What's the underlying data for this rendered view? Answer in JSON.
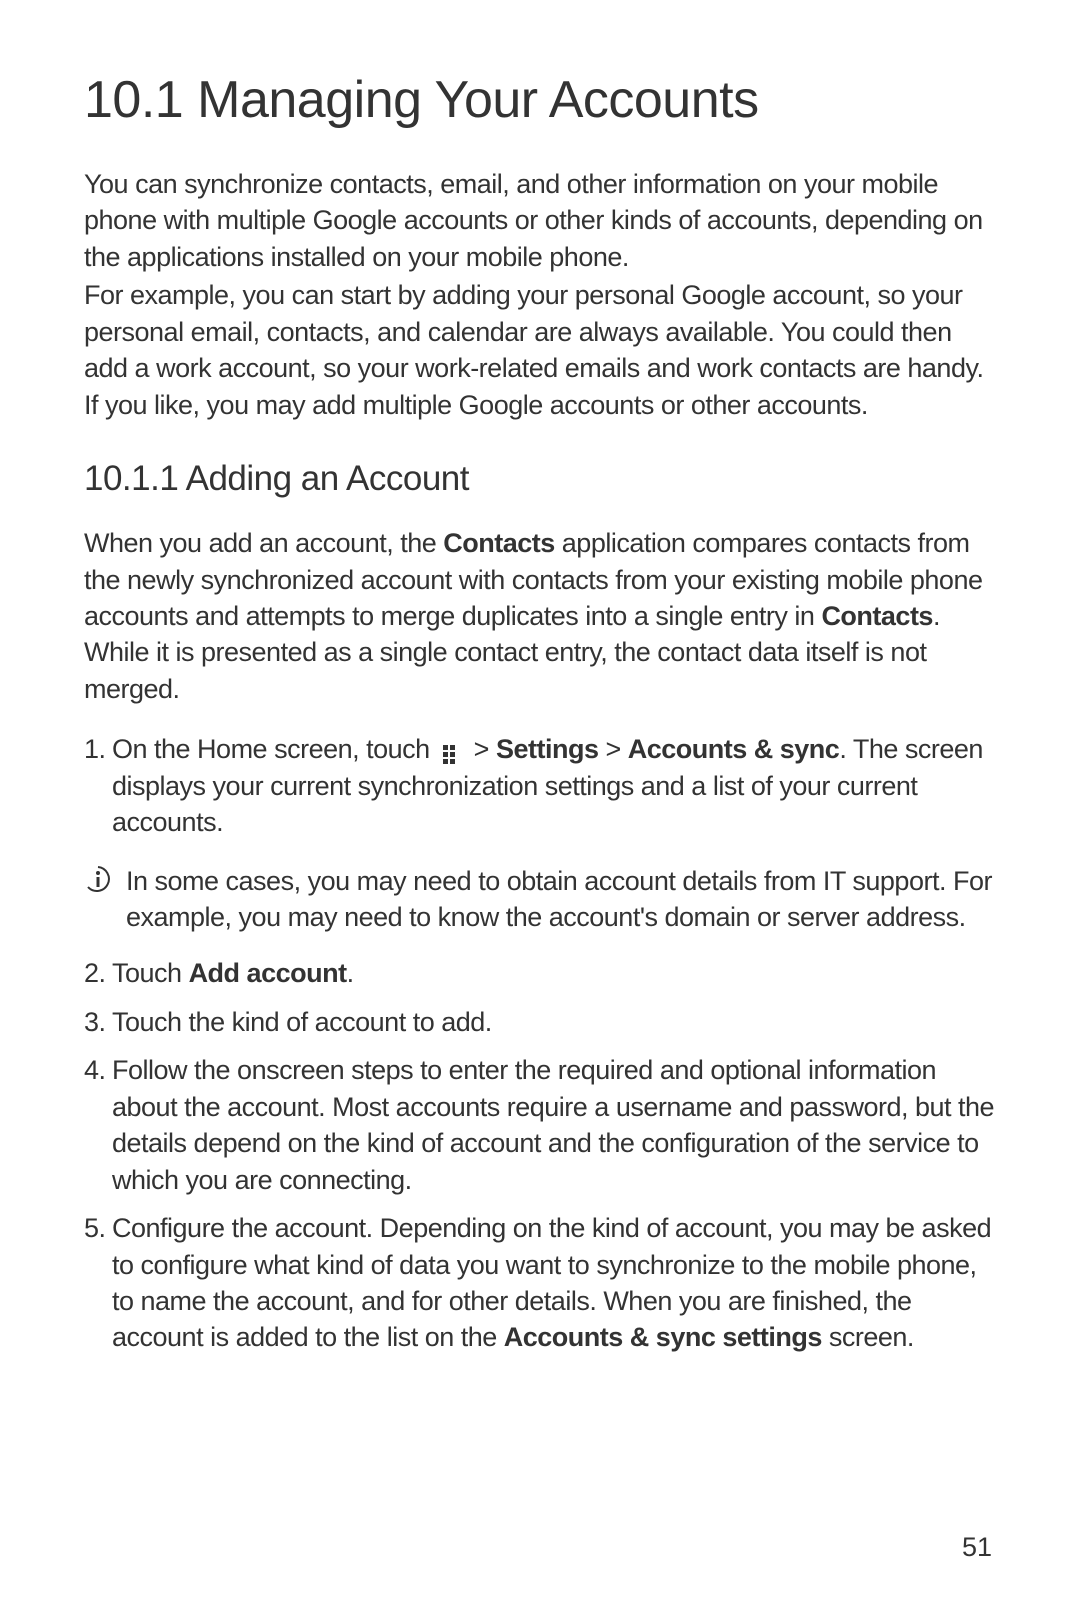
{
  "heading": "10.1  Managing Your Accounts",
  "intro1": "You can synchronize contacts, email, and other information on your mobile phone with multiple Google accounts or other kinds of accounts, depending on the applications installed on your mobile phone.",
  "intro2": "For example, you can start by adding your personal Google account, so your personal email, contacts, and calendar are always available. You could then add a work account, so your work-related emails and work contacts are handy. If you like, you may add multiple Google accounts or other accounts.",
  "subheading": "10.1.1  Adding an Account",
  "subpara_a": "When you add an account, the ",
  "subpara_b_bold": "Contacts",
  "subpara_c": " application compares contacts from the newly synchronized account with contacts from your existing mobile phone accounts and attempts to merge duplicates into a single entry in ",
  "subpara_d_bold": "Contacts",
  "subpara_e": ". While it is presented as a single contact entry, the contact data itself is not merged.",
  "step1_a": "On the Home screen, touch ",
  "step1_b": "  > ",
  "step1_c_bold": "Settings",
  "step1_d": " > ",
  "step1_e_bold": "Accounts & sync",
  "step1_f": ". The screen displays your current synchronization settings and a list of your current accounts.",
  "note_text": "In some cases, you may need to obtain account details from IT support. For example, you may need to know the account's domain or server address.",
  "step2_a": "Touch ",
  "step2_b_bold": "Add account",
  "step2_c": ".",
  "step3": "Touch the kind of account to add.",
  "step4": "Follow the onscreen steps to enter the required and optional information about the account. Most accounts require a username and password, but the details depend on the kind of account and the configuration of the service to which you are connecting.",
  "step5_a": "Configure the account. Depending on the kind of account, you may be asked to configure what kind of data you want to synchronize to the mobile phone, to name the account, and for other details. When you are finished, the account is added to the list on the ",
  "step5_b_bold": "Accounts & sync settings",
  "step5_c": " screen.",
  "page_number": "51",
  "step_numbers": {
    "s1": "1.",
    "s2": "2.",
    "s3": "3.",
    "s4": "4.",
    "s5": "5."
  }
}
